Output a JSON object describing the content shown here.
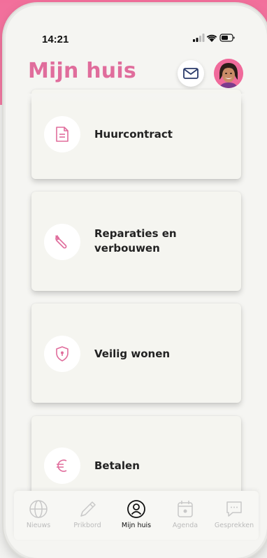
{
  "status_bar": {
    "time": "14:21"
  },
  "header": {
    "title": "Mijn huis",
    "mail_icon": "envelope-icon",
    "avatar_icon": "user-avatar"
  },
  "colors": {
    "brand_pink": "#e06d9c",
    "header_bg": "#f26f9b"
  },
  "cards": [
    {
      "label": "Huurcontract",
      "icon": "document-icon"
    },
    {
      "label": "Reparaties en verbouwen",
      "icon": "wrench-icon"
    },
    {
      "label": "Veilig wonen",
      "icon": "shield-lock-icon"
    },
    {
      "label": "Betalen",
      "icon": "euro-icon"
    }
  ],
  "tabbar": {
    "items": [
      {
        "label": "Nieuws",
        "icon": "globe-icon",
        "active": false
      },
      {
        "label": "Prikbord",
        "icon": "pencil-icon",
        "active": false
      },
      {
        "label": "Mijn huis",
        "icon": "person-icon",
        "active": true
      },
      {
        "label": "Agenda",
        "icon": "calendar-icon",
        "active": false
      },
      {
        "label": "Gesprekken",
        "icon": "chat-icon",
        "active": false
      }
    ]
  }
}
